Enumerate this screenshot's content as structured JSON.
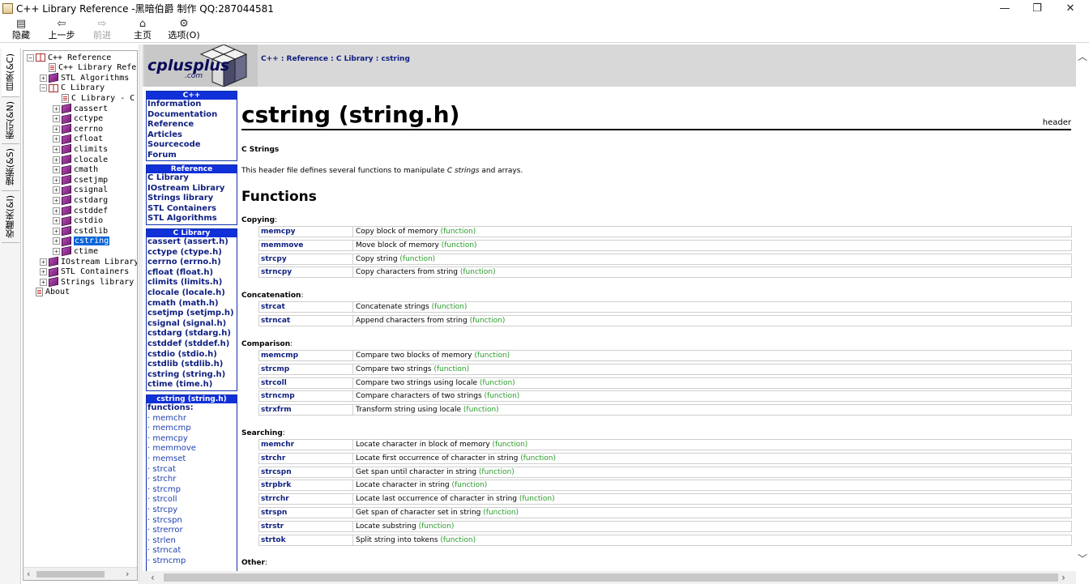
{
  "window": {
    "title": "C++ Library Reference -黑暗伯爵 制作 QQ:287044581",
    "minimize": "—",
    "restore": "❐",
    "close": "✕"
  },
  "toolbar": {
    "hide": "隐藏",
    "back": "上一步",
    "forward": "前进",
    "home": "主页",
    "options": "选项(O)"
  },
  "vtabs": [
    "目录(&C)",
    "索引(&N)",
    "搜索(&S)",
    "收藏夹(&I)"
  ],
  "tree": [
    {
      "label": "C++ Reference",
      "depth": 0,
      "exp": "−",
      "icon": "book-open"
    },
    {
      "label": "C++ Library Refe",
      "depth": 1,
      "exp": "",
      "icon": "page"
    },
    {
      "label": "STL Algorithms",
      "depth": 1,
      "exp": "+",
      "icon": "book"
    },
    {
      "label": "C Library",
      "depth": 1,
      "exp": "−",
      "icon": "book-open"
    },
    {
      "label": "C Library - C",
      "depth": 2,
      "exp": "",
      "icon": "page"
    },
    {
      "label": "cassert",
      "depth": 2,
      "exp": "+",
      "icon": "book"
    },
    {
      "label": "cctype",
      "depth": 2,
      "exp": "+",
      "icon": "book"
    },
    {
      "label": "cerrno",
      "depth": 2,
      "exp": "+",
      "icon": "book"
    },
    {
      "label": "cfloat",
      "depth": 2,
      "exp": "+",
      "icon": "book"
    },
    {
      "label": "climits",
      "depth": 2,
      "exp": "+",
      "icon": "book"
    },
    {
      "label": "clocale",
      "depth": 2,
      "exp": "+",
      "icon": "book"
    },
    {
      "label": "cmath",
      "depth": 2,
      "exp": "+",
      "icon": "book"
    },
    {
      "label": "csetjmp",
      "depth": 2,
      "exp": "+",
      "icon": "book"
    },
    {
      "label": "csignal",
      "depth": 2,
      "exp": "+",
      "icon": "book"
    },
    {
      "label": "cstdarg",
      "depth": 2,
      "exp": "+",
      "icon": "book"
    },
    {
      "label": "cstddef",
      "depth": 2,
      "exp": "+",
      "icon": "book"
    },
    {
      "label": "cstdio",
      "depth": 2,
      "exp": "+",
      "icon": "book"
    },
    {
      "label": "cstdlib",
      "depth": 2,
      "exp": "+",
      "icon": "book"
    },
    {
      "label": "cstring",
      "depth": 2,
      "exp": "+",
      "icon": "book",
      "selected": true
    },
    {
      "label": "ctime",
      "depth": 2,
      "exp": "+",
      "icon": "book"
    },
    {
      "label": "IOstream Library",
      "depth": 1,
      "exp": "+",
      "icon": "book"
    },
    {
      "label": "STL Containers",
      "depth": 1,
      "exp": "+",
      "icon": "book"
    },
    {
      "label": "Strings library",
      "depth": 1,
      "exp": "+",
      "icon": "book"
    },
    {
      "label": "About",
      "depth": 0,
      "exp": "",
      "icon": "page"
    }
  ],
  "page": {
    "breadcrumb": "C++ : Reference : C Library : cstring",
    "logo_text": "cplusplus",
    "logo_sub": ".com",
    "title": "cstring (string.h)",
    "header_tag": "header",
    "subtitle": "C Strings",
    "intro_before": "This header file defines several functions to manipulate ",
    "intro_em": "C strings",
    "intro_after": " and arrays.",
    "functions_heading": "Functions",
    "kind_label": "(function)"
  },
  "nav": {
    "cpp": {
      "head": "C++",
      "items": [
        "Information",
        "Documentation",
        "Reference",
        "Articles",
        "Sourcecode",
        "Forum"
      ]
    },
    "reference": {
      "head": "Reference",
      "items": [
        "C Library",
        "IOstream Library",
        "Strings library",
        "STL Containers",
        "STL Algorithms"
      ]
    },
    "clib": {
      "head": "C Library",
      "items": [
        "cassert (assert.h)",
        "cctype (ctype.h)",
        "cerrno (errno.h)",
        "cfloat (float.h)",
        "climits (limits.h)",
        "clocale (locale.h)",
        "cmath (math.h)",
        "csetjmp (setjmp.h)",
        "csignal (signal.h)",
        "cstdarg (stdarg.h)",
        "cstddef (stddef.h)",
        "cstdio (stdio.h)",
        "cstdlib (stdlib.h)",
        "cstring (string.h)",
        "ctime (time.h)"
      ]
    },
    "cstring": {
      "head": "cstring (string.h)",
      "functions_label": "functions:",
      "items": [
        "· memchr",
        "· memcmp",
        "· memcpy",
        "· memmove",
        "· memset",
        "· strcat",
        "· strchr",
        "· strcmp",
        "· strcoll",
        "· strcpy",
        "· strcspn",
        "· strerror",
        "· strlen",
        "· strncat",
        "· strncmp"
      ]
    }
  },
  "groups": [
    {
      "label": "Copying",
      "rows": [
        {
          "name": "memcpy",
          "desc": "Copy block of memory"
        },
        {
          "name": "memmove",
          "desc": "Move block of memory"
        },
        {
          "name": "strcpy",
          "desc": "Copy string"
        },
        {
          "name": "strncpy",
          "desc": "Copy characters from string"
        }
      ]
    },
    {
      "label": "Concatenation",
      "rows": [
        {
          "name": "strcat",
          "desc": "Concatenate strings"
        },
        {
          "name": "strncat",
          "desc": "Append characters from string"
        }
      ]
    },
    {
      "label": "Comparison",
      "rows": [
        {
          "name": "memcmp",
          "desc": "Compare two blocks of memory"
        },
        {
          "name": "strcmp",
          "desc": "Compare two strings"
        },
        {
          "name": "strcoll",
          "desc": "Compare two strings using locale"
        },
        {
          "name": "strncmp",
          "desc": "Compare characters of two strings"
        },
        {
          "name": "strxfrm",
          "desc": "Transform string using locale"
        }
      ]
    },
    {
      "label": "Searching",
      "rows": [
        {
          "name": "memchr",
          "desc": "Locate character in block of memory"
        },
        {
          "name": "strchr",
          "desc": "Locate first occurrence of character in string"
        },
        {
          "name": "strcspn",
          "desc": "Get span until character in string"
        },
        {
          "name": "strpbrk",
          "desc": "Locate character in string"
        },
        {
          "name": "strrchr",
          "desc": "Locate last occurrence of character in string"
        },
        {
          "name": "strspn",
          "desc": "Get span of character set in string"
        },
        {
          "name": "strstr",
          "desc": "Locate substring"
        },
        {
          "name": "strtok",
          "desc": "Split string into tokens"
        }
      ]
    },
    {
      "label": "Other",
      "rows": []
    }
  ]
}
